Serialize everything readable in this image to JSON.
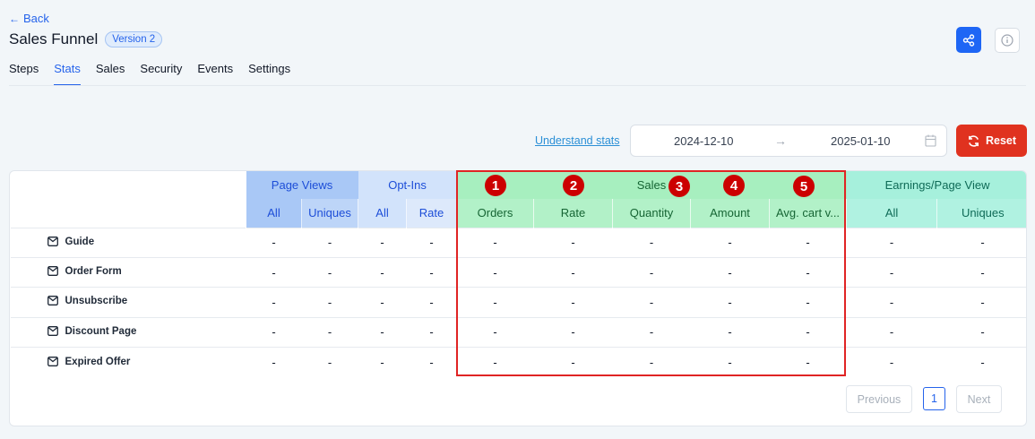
{
  "header": {
    "back_label": "Back",
    "title": "Sales Funnel",
    "version_badge": "Version 2"
  },
  "tabs": [
    {
      "label": "Steps",
      "active": false
    },
    {
      "label": "Stats",
      "active": true
    },
    {
      "label": "Sales",
      "active": false
    },
    {
      "label": "Security",
      "active": false
    },
    {
      "label": "Events",
      "active": false
    },
    {
      "label": "Settings",
      "active": false
    }
  ],
  "toolbar": {
    "understand_link": "Understand stats",
    "date_from": "2024-12-10",
    "date_to": "2025-01-10",
    "reset_label": "Reset"
  },
  "table": {
    "groups": {
      "page_views": "Page Views",
      "opt_ins": "Opt-Ins",
      "sales": "Sales",
      "earnings": "Earnings/Page View"
    },
    "subheaders": {
      "pv_all": "All",
      "pv_uniques": "Uniques",
      "oi_all": "All",
      "oi_rate": "Rate",
      "orders": "Orders",
      "rate": "Rate",
      "quantity": "Quantity",
      "amount": "Amount",
      "avg_cart": "Avg. cart v...",
      "ea_all": "All",
      "ea_uniques": "Uniques"
    },
    "rows": [
      {
        "name": "Guide",
        "values": [
          "-",
          "-",
          "-",
          "-",
          "-",
          "-",
          "-",
          "-",
          "-",
          "-",
          "-"
        ]
      },
      {
        "name": "Order Form",
        "values": [
          "-",
          "-",
          "-",
          "-",
          "-",
          "-",
          "-",
          "-",
          "-",
          "-",
          "-"
        ]
      },
      {
        "name": "Unsubscribe",
        "values": [
          "-",
          "-",
          "-",
          "-",
          "-",
          "-",
          "-",
          "-",
          "-",
          "-",
          "-"
        ]
      },
      {
        "name": "Discount Page",
        "values": [
          "-",
          "-",
          "-",
          "-",
          "-",
          "-",
          "-",
          "-",
          "-",
          "-",
          "-"
        ]
      },
      {
        "name": "Expired Offer",
        "values": [
          "-",
          "-",
          "-",
          "-",
          "-",
          "-",
          "-",
          "-",
          "-",
          "-",
          "-"
        ]
      }
    ]
  },
  "annotations": {
    "markers": [
      "1",
      "2",
      "3",
      "4",
      "5"
    ],
    "highlight_color": "#e02424"
  },
  "pagination": {
    "prev_label": "Previous",
    "current_page": "1",
    "next_label": "Next"
  },
  "colors": {
    "accent": "#2563eb",
    "reset": "#e0321f",
    "page_views_header": "#a9c8f6",
    "sales_header": "#a7efbf",
    "earnings_header": "#a6f0dc"
  }
}
